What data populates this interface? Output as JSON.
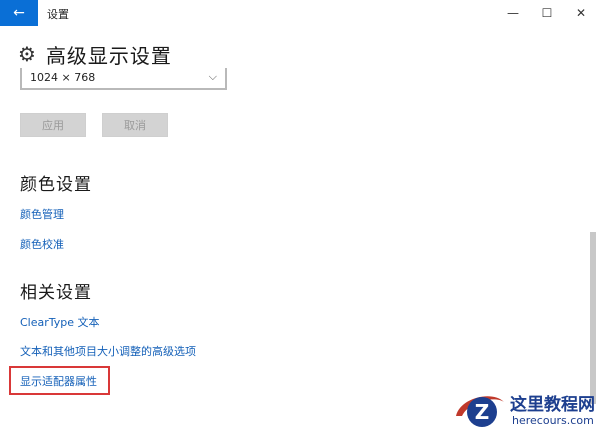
{
  "window": {
    "title": "设置",
    "back_glyph": "←",
    "minimize_glyph": "—",
    "maximize_glyph": "☐",
    "close_glyph": "✕",
    "accent_color": "#0a6fd6"
  },
  "header": {
    "gear_glyph": "⚙",
    "title": "高级显示设置"
  },
  "resolution": {
    "value": "1024 × 768",
    "chevron": "⌵"
  },
  "actions": {
    "apply": "应用",
    "cancel": "取消"
  },
  "color_section": {
    "title": "颜色设置",
    "links": [
      "颜色管理",
      "颜色校准"
    ]
  },
  "related_section": {
    "title": "相关设置",
    "links": [
      "ClearType 文本",
      "文本和其他项目大小调整的高级选项",
      "显示适配器属性"
    ]
  },
  "watermark": {
    "brand": "这里教程网",
    "domain": "herecours.com"
  }
}
